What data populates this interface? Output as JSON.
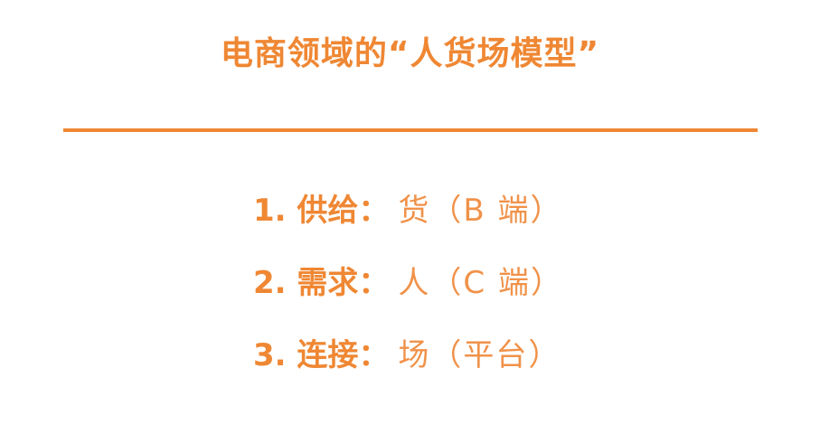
{
  "title": "电商领域的“人货场模型”",
  "items": [
    {
      "label": "1. 供给",
      "colon": "：",
      "value": "货（B 端）"
    },
    {
      "label": "2. 需求",
      "colon": "：",
      "value": "人（C 端）"
    },
    {
      "label": "3. 连接",
      "colon": "：",
      "value": "场（平台）"
    }
  ],
  "colors": {
    "accent": "#ef8733"
  }
}
